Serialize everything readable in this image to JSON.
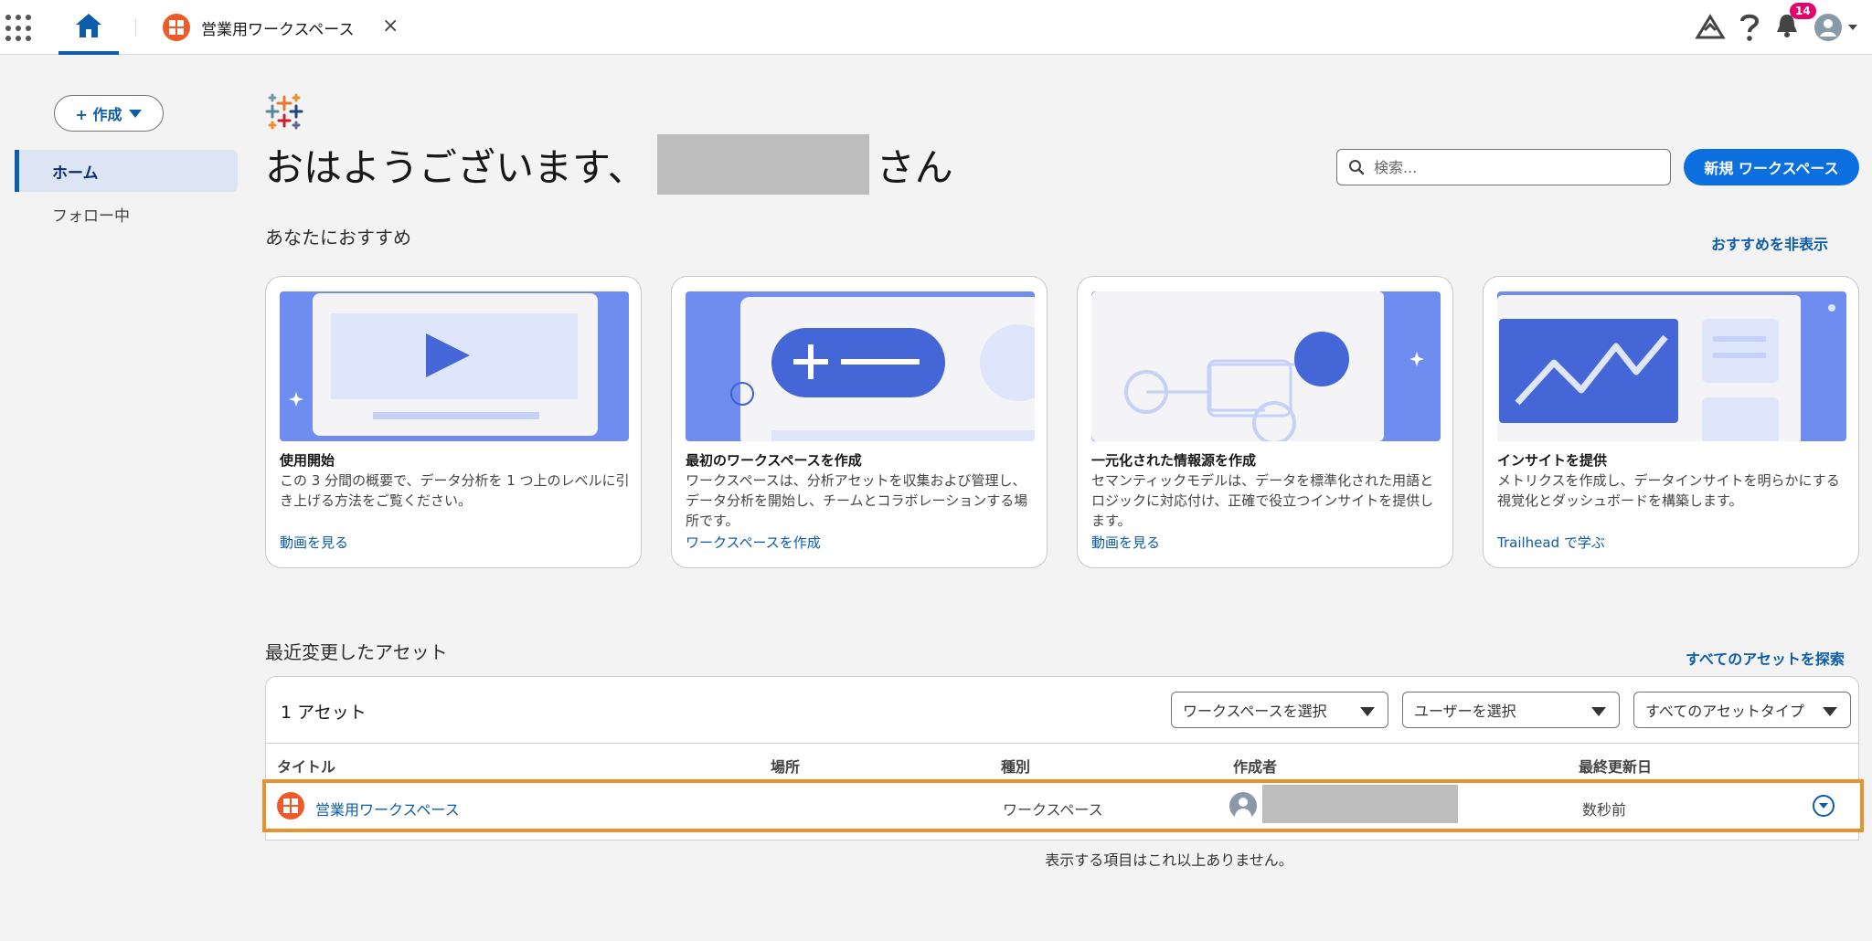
{
  "topbar": {
    "tab_title": "営業用ワークスペース",
    "close_symbol": "×",
    "notification_count": "14"
  },
  "sidebar": {
    "create_label": "+ 作成",
    "items": [
      {
        "label": "ホーム"
      },
      {
        "label": "フォロー中"
      }
    ]
  },
  "header": {
    "greeting_prefix": "おはようございます、",
    "greeting_suffix": "さん",
    "search_placeholder": "検索...",
    "new_workspace_label": "新規 ワークスペース"
  },
  "recommendations": {
    "title": "あなたにおすすめ",
    "hide_label": "おすすめを非表示",
    "cards": [
      {
        "title": "使用開始",
        "description": "この 3 分間の概要で、データ分析を 1 つ上のレベルに引き上げる方法をご覧ください。",
        "link": "動画を見る"
      },
      {
        "title": "最初のワークスペースを作成",
        "description": "ワークスペースは、分析アセットを収集および管理し、データ分析を開始し、チームとコラボレーションする場所です。",
        "link": "ワークスペースを作成"
      },
      {
        "title": "一元化された情報源を作成",
        "description": "セマンティックモデルは、データを標準化された用語とロジックに対応付け、正確で役立つインサイトを提供します。",
        "link": "動画を見る"
      },
      {
        "title": "インサイトを提供",
        "description": "メトリクスを作成し、データインサイトを明らかにする視覚化とダッシュボードを構築します。",
        "link": "Trailhead で学ぶ"
      }
    ]
  },
  "assets": {
    "title": "最近変更したアセット",
    "explore_label": "すべてのアセットを探索",
    "count_label": "1 アセット",
    "filters": {
      "workspace": "ワークスペースを選択",
      "user": "ユーザーを選択",
      "type": "すべてのアセットタイプ"
    },
    "columns": [
      "タイトル",
      "場所",
      "種別",
      "作成者",
      "最終更新日"
    ],
    "rows": [
      {
        "title": "営業用ワークスペース",
        "location": "",
        "type": "ワークスペース",
        "updated": "数秒前"
      }
    ],
    "end_message": "表示する項目はこれ以上ありません。"
  }
}
